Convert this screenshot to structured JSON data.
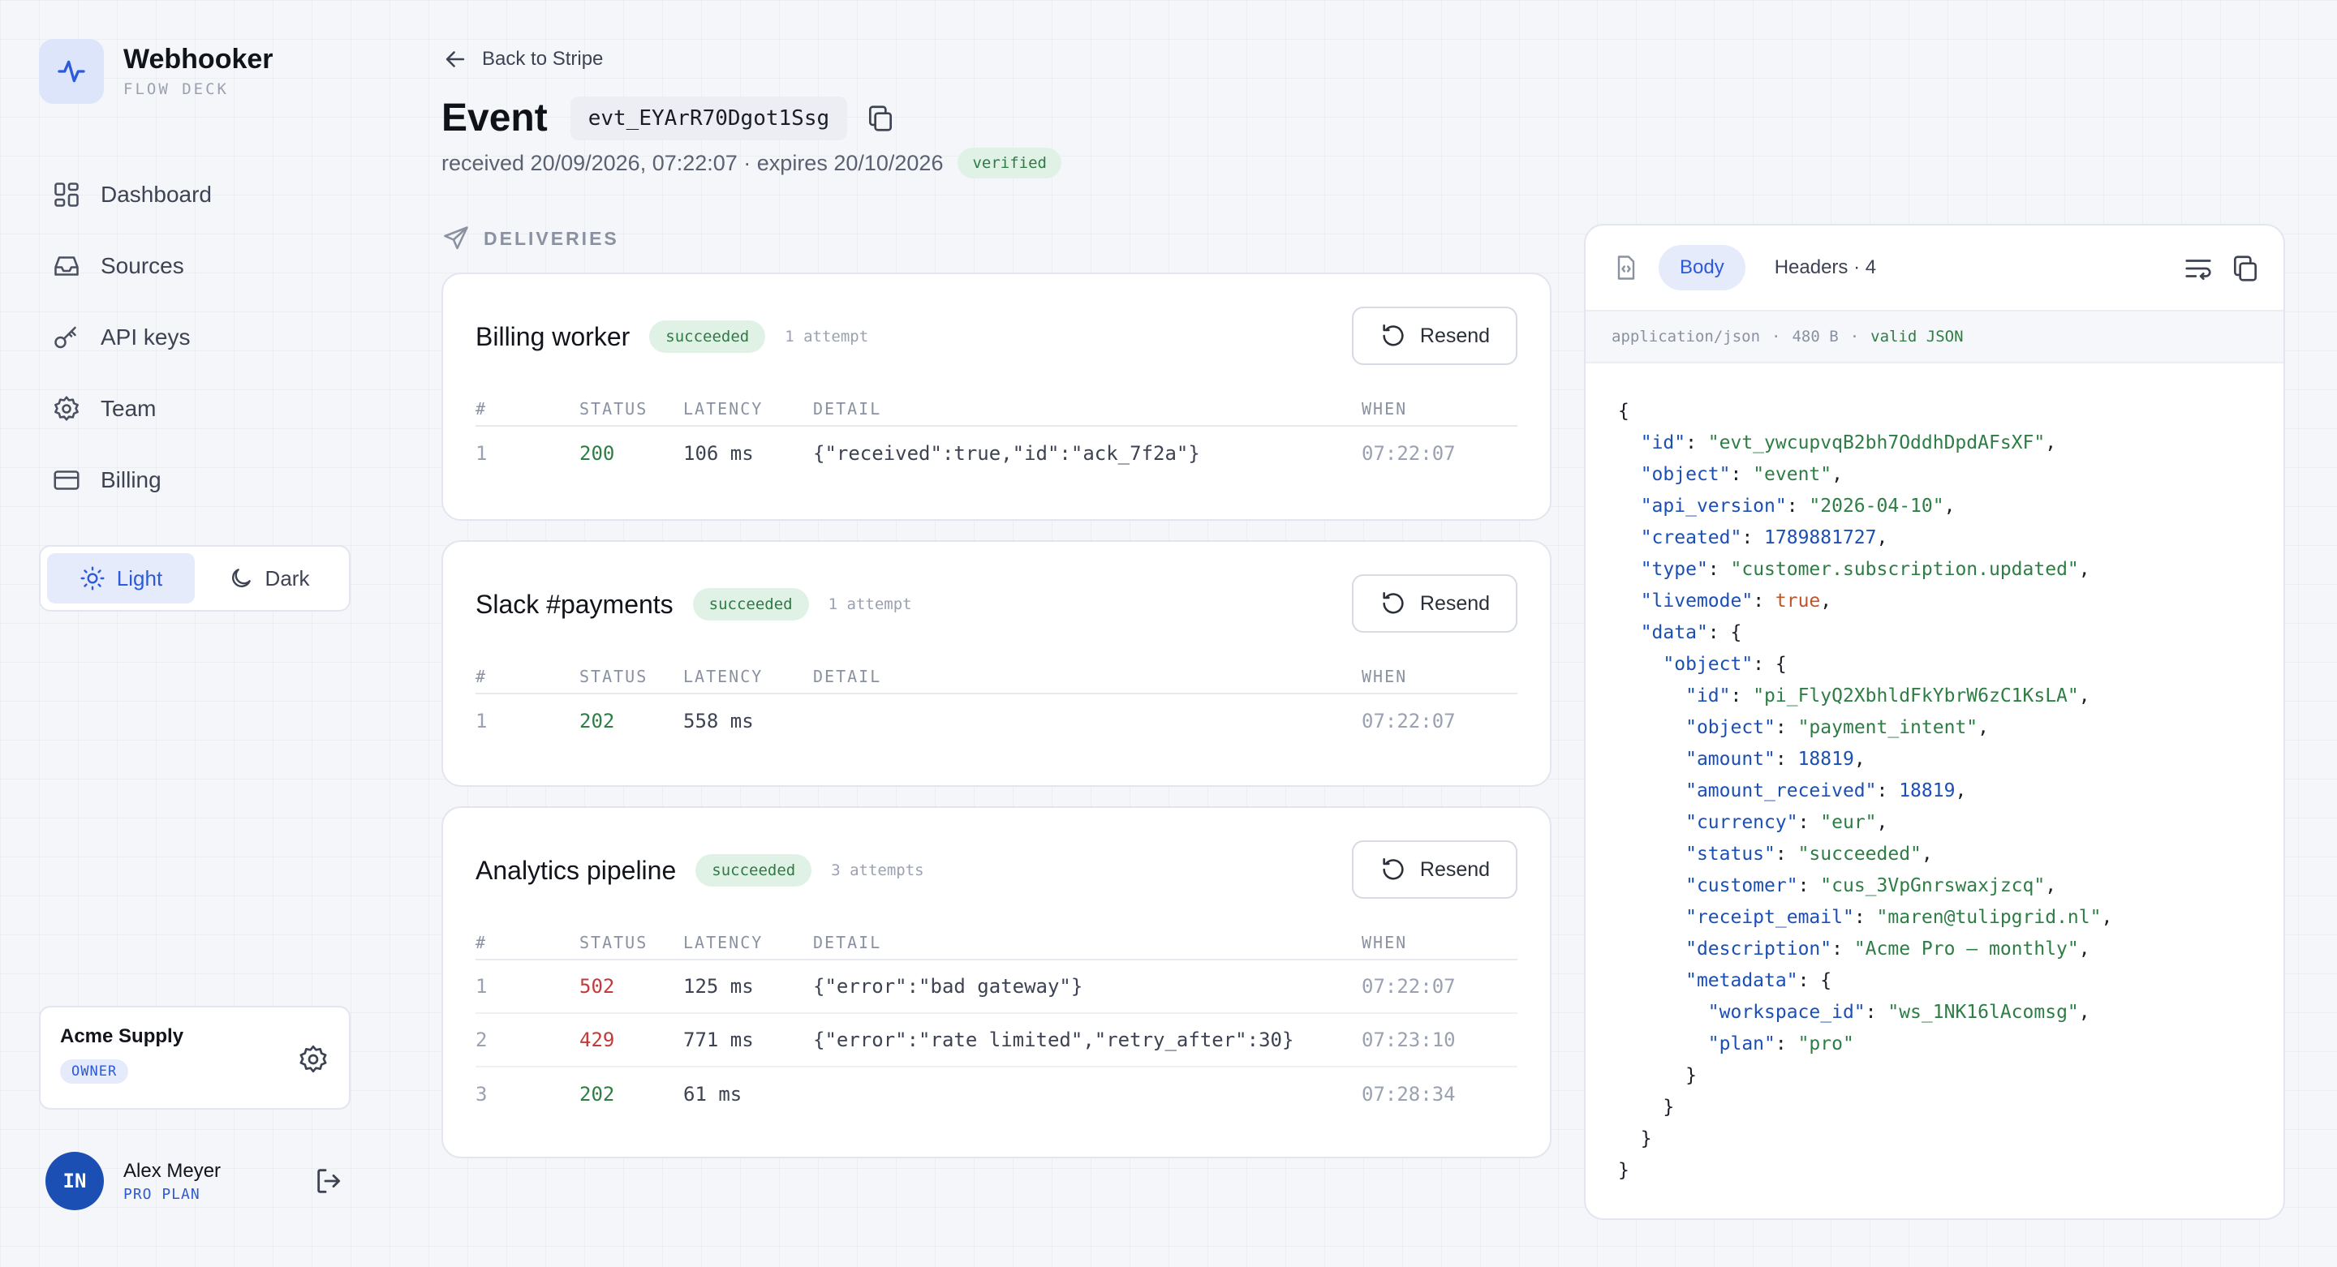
{
  "brand": {
    "name": "Webhooker",
    "subtitle": "FLOW DECK"
  },
  "nav": [
    {
      "label": "Dashboard",
      "icon": "dashboard-icon"
    },
    {
      "label": "Sources",
      "icon": "inbox-icon"
    },
    {
      "label": "API keys",
      "icon": "key-icon"
    },
    {
      "label": "Team",
      "icon": "gear-icon"
    },
    {
      "label": "Billing",
      "icon": "credit-card-icon"
    }
  ],
  "theme": {
    "light_label": "Light",
    "dark_label": "Dark",
    "selected": "Light"
  },
  "org": {
    "name": "Acme Supply",
    "role": "OWNER"
  },
  "user": {
    "initials": "IN",
    "name": "Alex Meyer",
    "plan": "PRO PLAN"
  },
  "header": {
    "back_label": "Back to Stripe",
    "title": "Event",
    "event_id": "evt_EYArR70Dgot1Ssg",
    "meta": "received 20/09/2026, 07:22:07 · expires 20/10/2026",
    "verified_label": "verified"
  },
  "deliveries": {
    "section_label": "DELIVERIES",
    "resend_label": "Resend",
    "columns": [
      "#",
      "STATUS",
      "LATENCY",
      "DETAIL",
      "WHEN"
    ],
    "items": [
      {
        "name": "Billing worker",
        "status": "succeeded",
        "attempts": "1 attempt",
        "rows": [
          {
            "n": "1",
            "code": "200",
            "latency": "106 ms",
            "detail": "{\"received\":true,\"id\":\"ack_7f2a\"}",
            "when": "07:22:07",
            "ok": true
          }
        ]
      },
      {
        "name": "Slack #payments",
        "status": "succeeded",
        "attempts": "1 attempt",
        "rows": [
          {
            "n": "1",
            "code": "202",
            "latency": "558 ms",
            "detail": "",
            "when": "07:22:07",
            "ok": true
          }
        ]
      },
      {
        "name": "Analytics pipeline",
        "status": "succeeded",
        "attempts": "3 attempts",
        "rows": [
          {
            "n": "1",
            "code": "502",
            "latency": "125 ms",
            "detail": "{\"error\":\"bad gateway\"}",
            "when": "07:22:07",
            "ok": false
          },
          {
            "n": "2",
            "code": "429",
            "latency": "771 ms",
            "detail": "{\"error\":\"rate limited\",\"retry_after\":30}",
            "when": "07:23:10",
            "ok": false
          },
          {
            "n": "3",
            "code": "202",
            "latency": "61 ms",
            "detail": "",
            "when": "07:28:34",
            "ok": true
          }
        ]
      }
    ]
  },
  "payload": {
    "tabs": {
      "body": "Body",
      "headers": "Headers · 4"
    },
    "content_type": "application/json",
    "size": "480 B",
    "validity": "valid JSON",
    "json_lines": [
      [
        [
          "p",
          "{"
        ]
      ],
      [
        [
          "p",
          "  "
        ],
        [
          "k",
          "\"id\""
        ],
        [
          "p",
          ": "
        ],
        [
          "s",
          "\"evt_ywcupvqB2bh7OddhDpdAFsXF\""
        ],
        [
          "p",
          ","
        ]
      ],
      [
        [
          "p",
          "  "
        ],
        [
          "k",
          "\"object\""
        ],
        [
          "p",
          ": "
        ],
        [
          "s",
          "\"event\""
        ],
        [
          "p",
          ","
        ]
      ],
      [
        [
          "p",
          "  "
        ],
        [
          "k",
          "\"api_version\""
        ],
        [
          "p",
          ": "
        ],
        [
          "s",
          "\"2026-04-10\""
        ],
        [
          "p",
          ","
        ]
      ],
      [
        [
          "p",
          "  "
        ],
        [
          "k",
          "\"created\""
        ],
        [
          "p",
          ": "
        ],
        [
          "n",
          "1789881727"
        ],
        [
          "p",
          ","
        ]
      ],
      [
        [
          "p",
          "  "
        ],
        [
          "k",
          "\"type\""
        ],
        [
          "p",
          ": "
        ],
        [
          "s",
          "\"customer.subscription.updated\""
        ],
        [
          "p",
          ","
        ]
      ],
      [
        [
          "p",
          "  "
        ],
        [
          "k",
          "\"livemode\""
        ],
        [
          "p",
          ": "
        ],
        [
          "b",
          "true"
        ],
        [
          "p",
          ","
        ]
      ],
      [
        [
          "p",
          "  "
        ],
        [
          "k",
          "\"data\""
        ],
        [
          "p",
          ": {"
        ]
      ],
      [
        [
          "p",
          "    "
        ],
        [
          "k",
          "\"object\""
        ],
        [
          "p",
          ": {"
        ]
      ],
      [
        [
          "p",
          "      "
        ],
        [
          "k",
          "\"id\""
        ],
        [
          "p",
          ": "
        ],
        [
          "s",
          "\"pi_FlyQ2XbhldFkYbrW6zC1KsLA\""
        ],
        [
          "p",
          ","
        ]
      ],
      [
        [
          "p",
          "      "
        ],
        [
          "k",
          "\"object\""
        ],
        [
          "p",
          ": "
        ],
        [
          "s",
          "\"payment_intent\""
        ],
        [
          "p",
          ","
        ]
      ],
      [
        [
          "p",
          "      "
        ],
        [
          "k",
          "\"amount\""
        ],
        [
          "p",
          ": "
        ],
        [
          "n",
          "18819"
        ],
        [
          "p",
          ","
        ]
      ],
      [
        [
          "p",
          "      "
        ],
        [
          "k",
          "\"amount_received\""
        ],
        [
          "p",
          ": "
        ],
        [
          "n",
          "18819"
        ],
        [
          "p",
          ","
        ]
      ],
      [
        [
          "p",
          "      "
        ],
        [
          "k",
          "\"currency\""
        ],
        [
          "p",
          ": "
        ],
        [
          "s",
          "\"eur\""
        ],
        [
          "p",
          ","
        ]
      ],
      [
        [
          "p",
          "      "
        ],
        [
          "k",
          "\"status\""
        ],
        [
          "p",
          ": "
        ],
        [
          "s",
          "\"succeeded\""
        ],
        [
          "p",
          ","
        ]
      ],
      [
        [
          "p",
          "      "
        ],
        [
          "k",
          "\"customer\""
        ],
        [
          "p",
          ": "
        ],
        [
          "s",
          "\"cus_3VpGnrswaxjzcq\""
        ],
        [
          "p",
          ","
        ]
      ],
      [
        [
          "p",
          "      "
        ],
        [
          "k",
          "\"receipt_email\""
        ],
        [
          "p",
          ": "
        ],
        [
          "s",
          "\"maren@tulipgrid.nl\""
        ],
        [
          "p",
          ","
        ]
      ],
      [
        [
          "p",
          "      "
        ],
        [
          "k",
          "\"description\""
        ],
        [
          "p",
          ": "
        ],
        [
          "s",
          "\"Acme Pro — monthly\""
        ],
        [
          "p",
          ","
        ]
      ],
      [
        [
          "p",
          "      "
        ],
        [
          "k",
          "\"metadata\""
        ],
        [
          "p",
          ": {"
        ]
      ],
      [
        [
          "p",
          "        "
        ],
        [
          "k",
          "\"workspace_id\""
        ],
        [
          "p",
          ": "
        ],
        [
          "s",
          "\"ws_1NK16lAcomsg\""
        ],
        [
          "p",
          ","
        ]
      ],
      [
        [
          "p",
          "        "
        ],
        [
          "k",
          "\"plan\""
        ],
        [
          "p",
          ": "
        ],
        [
          "s",
          "\"pro\""
        ]
      ],
      [
        [
          "p",
          "      }"
        ]
      ],
      [
        [
          "p",
          "    }"
        ]
      ],
      [
        [
          "p",
          "  }"
        ]
      ],
      [
        [
          "p",
          "}"
        ]
      ]
    ]
  }
}
